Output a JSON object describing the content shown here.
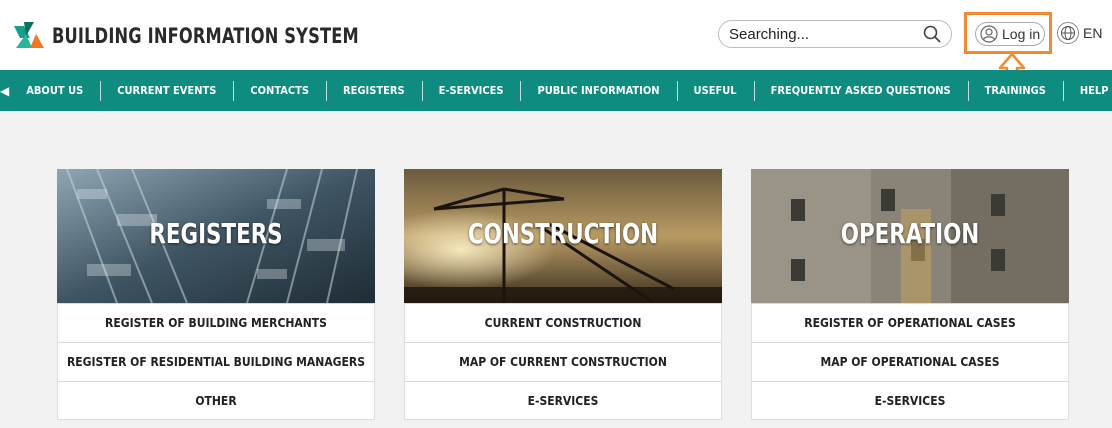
{
  "header": {
    "logo_text": "BUILDING INFORMATION SYSTEM",
    "search_placeholder": "Searching...",
    "login_label": "Log in",
    "lang_label": "EN"
  },
  "colors": {
    "nav_bg": "#0d8c7f",
    "highlight": "#f28b30",
    "logo_teal": "#14a08c",
    "logo_orange": "#f07820"
  },
  "nav": {
    "left_arrow": "◀",
    "right_arrow": "▶",
    "items": [
      "ABOUT US",
      "CURRENT EVENTS",
      "CONTACTS",
      "REGISTERS",
      "E-SERVICES",
      "PUBLIC INFORMATION",
      "USEFUL",
      "FREQUENTLY ASKED QUESTIONS",
      "TRAININGS",
      "HELP"
    ]
  },
  "cards": [
    {
      "title": "REGISTERS",
      "links": [
        "REGISTER OF BUILDING MERCHANTS",
        "REGISTER OF RESIDENTIAL BUILDING MANAGERS",
        "OTHER"
      ]
    },
    {
      "title": "CONSTRUCTION",
      "links": [
        "CURRENT CONSTRUCTION",
        "MAP OF CURRENT CONSTRUCTION",
        "E-SERVICES"
      ]
    },
    {
      "title": "OPERATION",
      "links": [
        "REGISTER OF OPERATIONAL CASES",
        "MAP OF OPERATIONAL CASES",
        "E-SERVICES"
      ]
    }
  ]
}
